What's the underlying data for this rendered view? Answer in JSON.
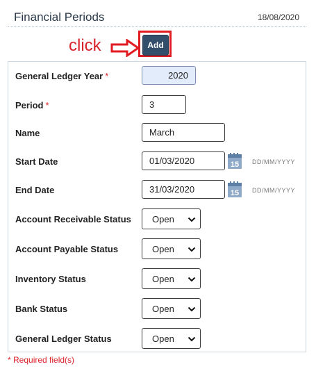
{
  "header": {
    "title": "Financial Periods",
    "date": "18/08/2020"
  },
  "annotation": {
    "click_text": "click"
  },
  "toolbar": {
    "add_label": "Add"
  },
  "form": {
    "gl_year": {
      "label": "General Ledger Year",
      "required": "*",
      "value": "2020"
    },
    "period": {
      "label": "Period",
      "required": "*",
      "value": "3"
    },
    "name": {
      "label": "Name",
      "value": "March"
    },
    "start_date": {
      "label": "Start Date",
      "value": "01/03/2020",
      "format": "DD/MM/YYYY",
      "icon": "calendar-icon",
      "icon_text": "15"
    },
    "end_date": {
      "label": "End Date",
      "value": "31/03/2020",
      "format": "DD/MM/YYYY",
      "icon": "calendar-icon",
      "icon_text": "15"
    },
    "ar_status": {
      "label": "Account Receivable Status",
      "value": "Open"
    },
    "ap_status": {
      "label": "Account Payable Status",
      "value": "Open"
    },
    "inv_status": {
      "label": "Inventory Status",
      "value": "Open"
    },
    "bank_status": {
      "label": "Bank Status",
      "value": "Open"
    },
    "gl_status": {
      "label": "General Ledger Status",
      "value": "Open"
    }
  },
  "footer": {
    "required_note": "* Required field(s)"
  },
  "colors": {
    "accent": "#334e6b",
    "highlight": "#e21a22",
    "year_field": "#e3ecfb"
  }
}
